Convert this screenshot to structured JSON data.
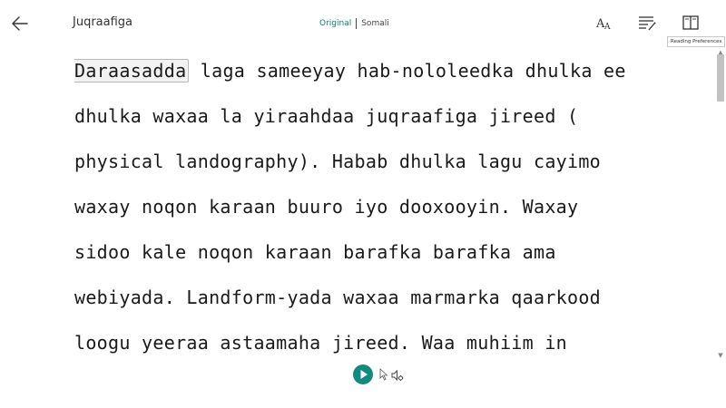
{
  "header": {
    "title": "Juqraafiga",
    "lang_original": "Original",
    "lang_somali": "Somali",
    "tooltip": "Reading Preferences"
  },
  "icons": {
    "back": "arrow-left-icon",
    "text_size": "text-size-icon",
    "grammar": "grammar-options-icon",
    "reading_prefs": "book-icon",
    "play": "play-icon",
    "cursor": "mouse-pointer-icon",
    "voice": "voice-settings-icon"
  },
  "colors": {
    "accent": "#0a7f74",
    "play_button": "#138a80"
  },
  "reader": {
    "highlighted_word": "Daraasadda",
    "first_line_rest": " laga sameeyay hab-nololeedka dhulka ee",
    "lines": [
      "dhulka waxaa la yiraahdaa juqraafiga jireed (",
      "physical landography). Habab dhulka lagu cayimo",
      "waxay noqon karaan buuro iyo dooxooyin. Waxay",
      "sidoo kale noqon karaan barafka barafka ama",
      "webiyada. Landform-yada waxaa marmarka qaarkood",
      "loogu yeeraa astaamaha jireed. Waa muhiim in"
    ]
  }
}
